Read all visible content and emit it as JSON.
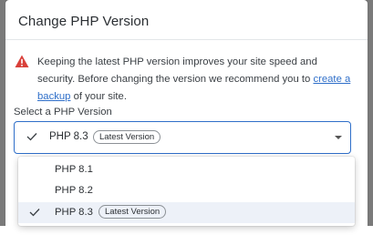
{
  "modal": {
    "title": "Change PHP Version",
    "warning": {
      "text_before": "Keeping the latest PHP version improves your site speed and security. Before changing the version we recommend you to ",
      "link": "create a backup",
      "text_after": " of your site."
    },
    "select": {
      "label": "Select a PHP Version",
      "selected_value": "PHP 8.3",
      "selected_badge": "Latest Version"
    },
    "options": [
      {
        "label": "PHP 8.1",
        "badge": "",
        "selected": false
      },
      {
        "label": "PHP 8.2",
        "badge": "",
        "selected": false
      },
      {
        "label": "PHP 8.3",
        "badge": "Latest Version",
        "selected": true
      }
    ]
  },
  "colors": {
    "accent": "#2f6fc9",
    "warning": "#d9403a",
    "selected_bg": "#edf1f8"
  },
  "icons": [
    "warning-icon",
    "check-icon",
    "chevron-down-icon"
  ]
}
